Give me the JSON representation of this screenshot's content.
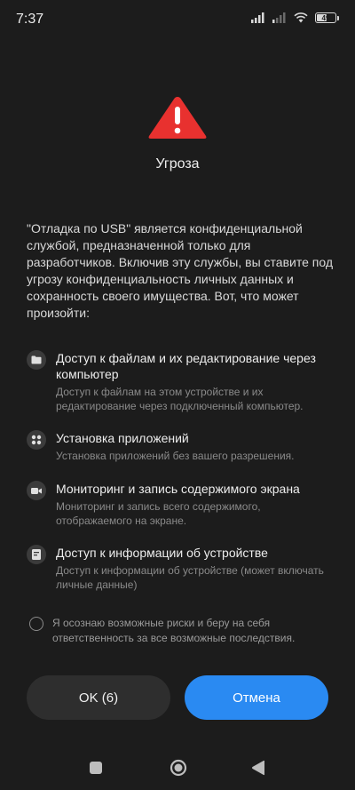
{
  "status_bar": {
    "time": "7:37",
    "battery_level": "49",
    "battery_fraction": 0.49
  },
  "dialog": {
    "title": "Угроза",
    "intro": "\"Отладка по USB\" является конфиденциальной службой, предназначенной только для разработчиков. Включив эту службы, вы ставите под угрозу конфиденциальность личных данных и сохранность своего имущества. Вот, что может произойти:",
    "permissions": [
      {
        "icon": "folder-icon",
        "title": "Доступ к файлам и их редактирование через компьютер",
        "description": "Доступ к файлам на этом устройстве и их редактирование через подключенный компьютер."
      },
      {
        "icon": "apps-icon",
        "title": "Установка приложений",
        "description": "Установка приложений без вашего разрешения."
      },
      {
        "icon": "video-camera-icon",
        "title": "Мониторинг и запись содержимого экрана",
        "description": "Мониторинг и запись всего содержимого, отображаемого на экране."
      },
      {
        "icon": "document-icon",
        "title": "Доступ к информации об устройстве",
        "description": "Доступ к информации об устройстве (может включать личные данные)"
      }
    ],
    "acknowledge": "Я осознаю возможные риски и беру на себя ответственность за все возможные последствия.",
    "ok_label": "OK (6)",
    "cancel_label": "Отмена"
  },
  "colors": {
    "background": "#1c1c1c",
    "warning": "#e8312f",
    "accent": "#2a8af2"
  }
}
